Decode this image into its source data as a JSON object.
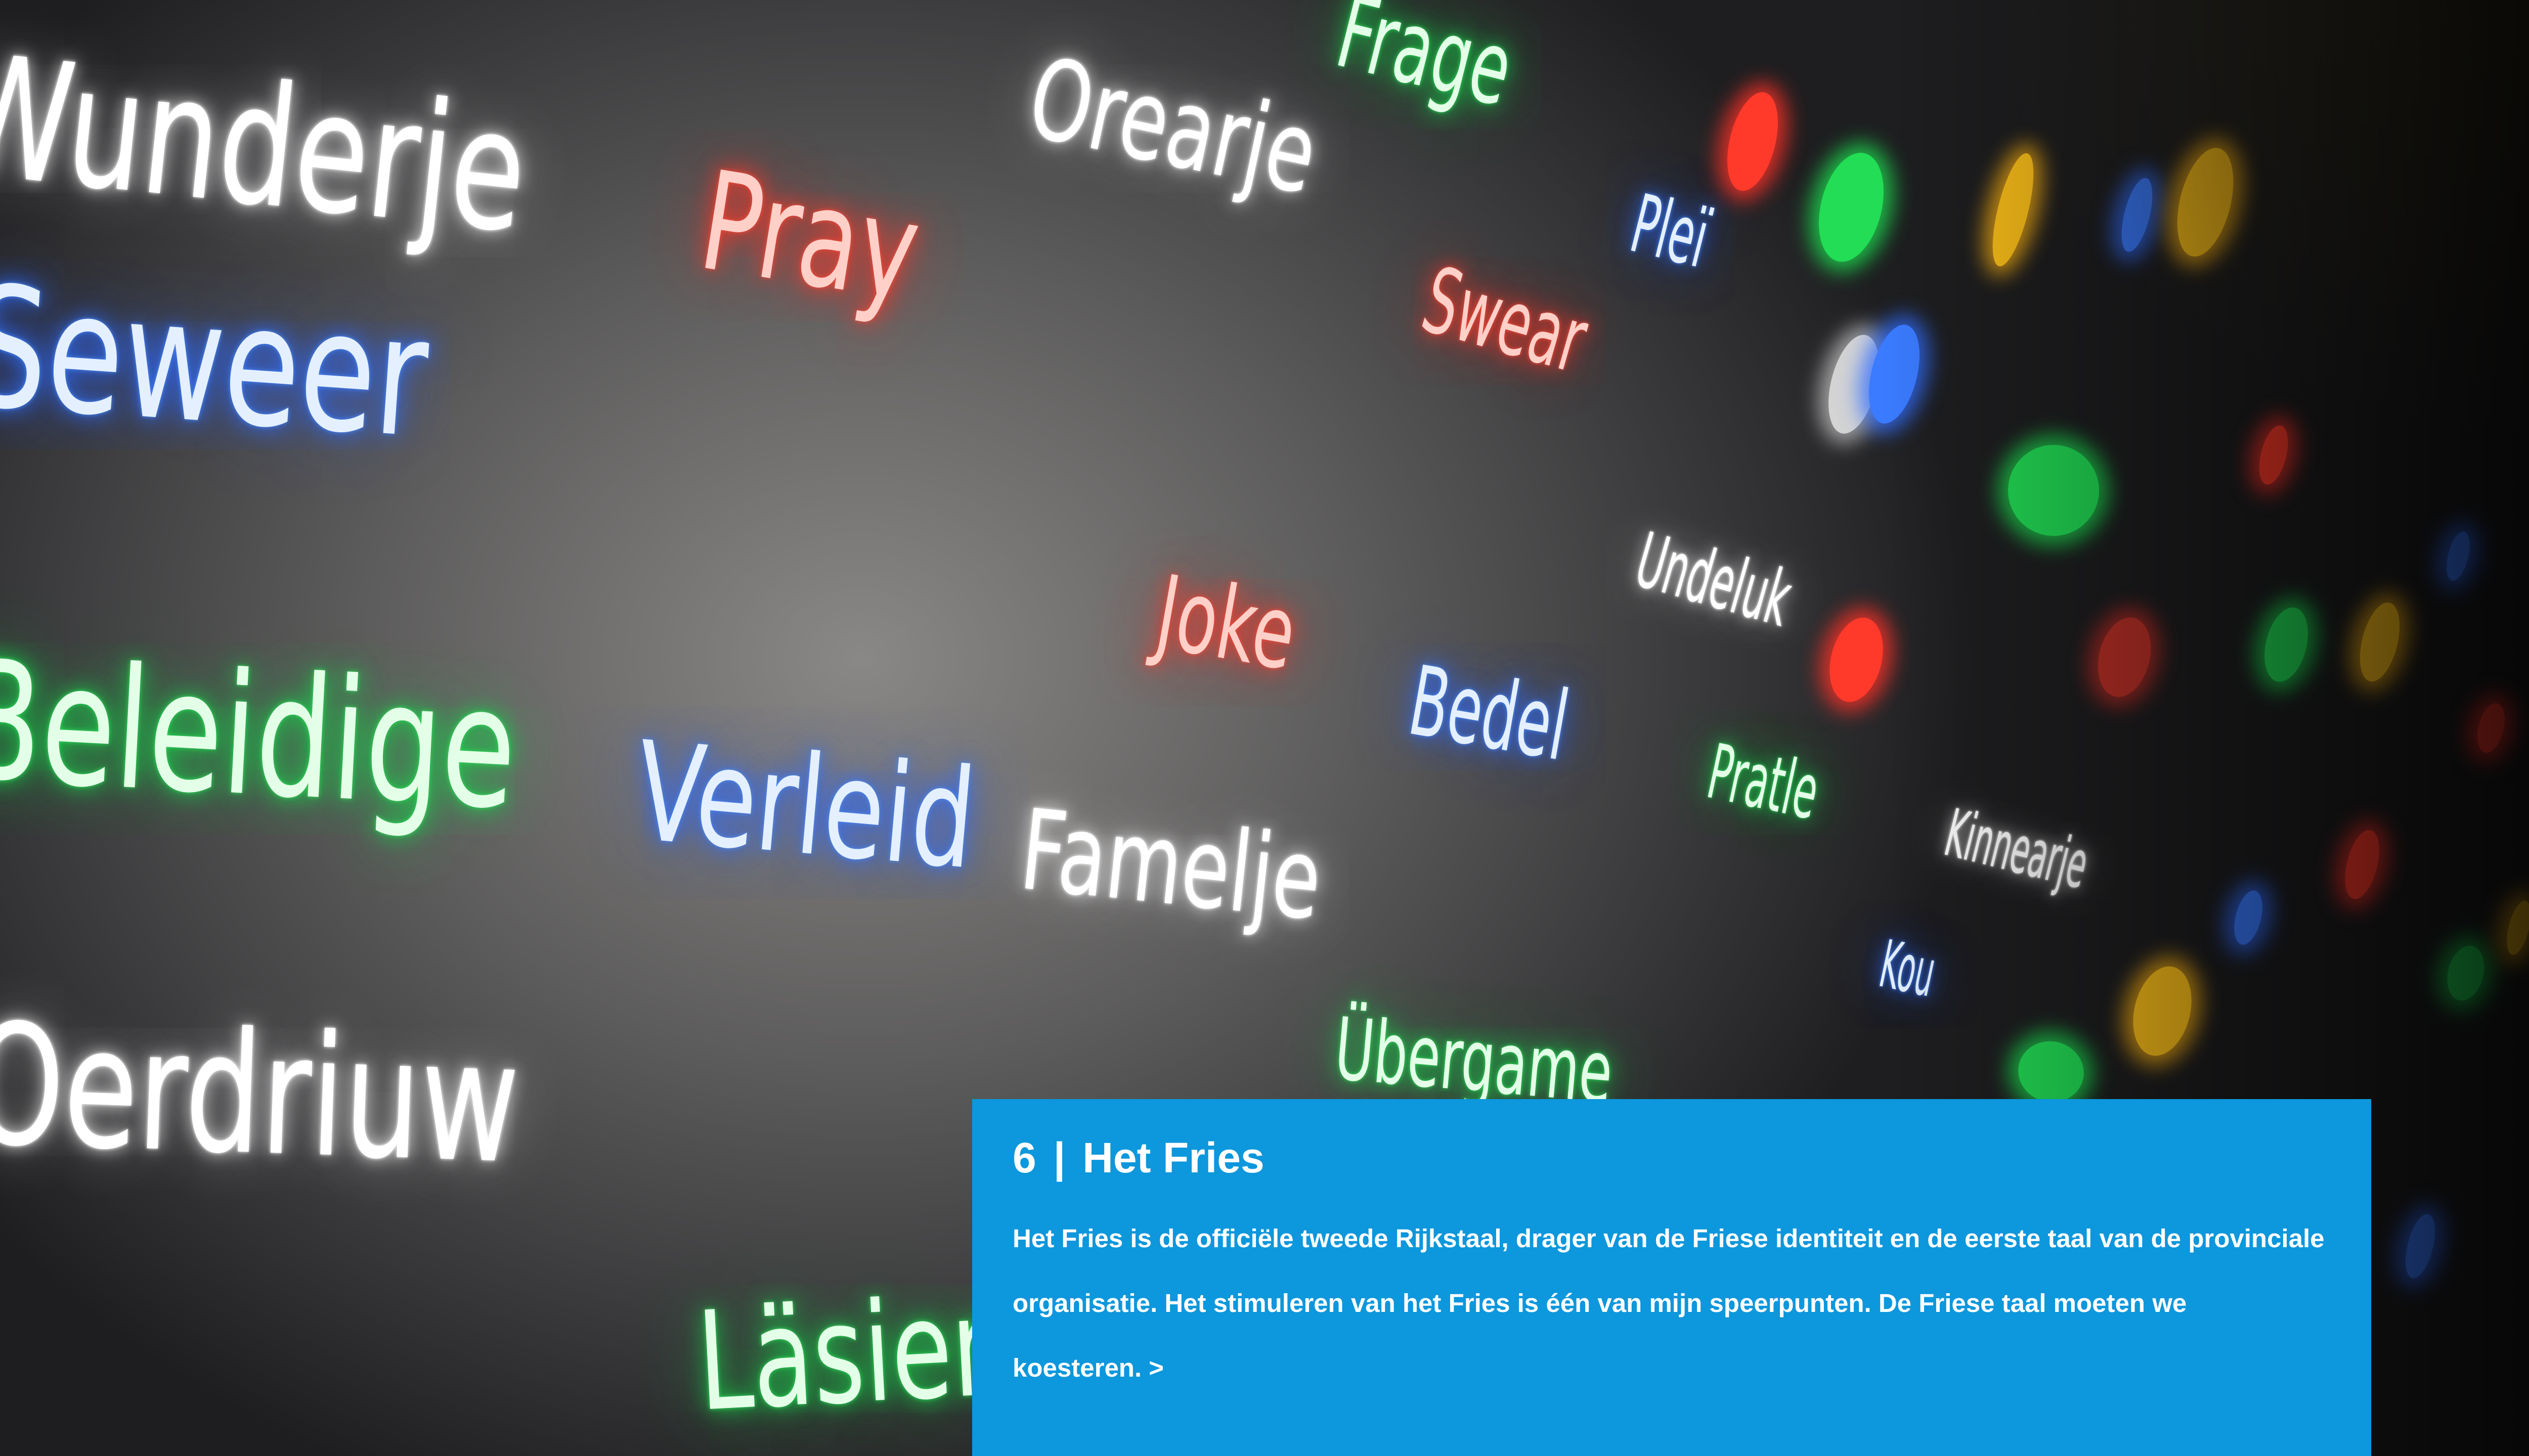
{
  "wall": {
    "words": {
      "wunderje": "Wunderje",
      "seweer": "Seweer",
      "beleidige": "Beleidige",
      "oerdriuw": "Oerdriuw",
      "pray": "Pray",
      "oranje": "Orearje",
      "frage": "Frage",
      "verleid": "Verleid",
      "famelje": "Famelje",
      "joke": "Joke",
      "bedel": "Bedel",
      "swear": "Swear",
      "plei": "Pleï",
      "undeluk": "Undeluk",
      "pratle": "Pratle",
      "ubergame": "Übergame",
      "lasien": "Läsien",
      "kinnearje": "Kinnearje",
      "kou": "Kou"
    },
    "colors": {
      "red": "#ff3a2a",
      "blue": "#2f6dff",
      "green": "#18d04a",
      "yellow": "#ffb000",
      "white": "#ffffff"
    }
  },
  "panel": {
    "number": "6",
    "separator": "|",
    "title": "Het Fries",
    "body": "Het Fries is de officiële tweede Rijkstaal, drager van de Friese identiteit en de eerste taal van de provinciale organisatie. Het stimuleren van het Fries is één van mijn speerpunten. De Friese taal moeten we koesteren.",
    "more_link": ">",
    "background_color": "#0d97dc"
  }
}
